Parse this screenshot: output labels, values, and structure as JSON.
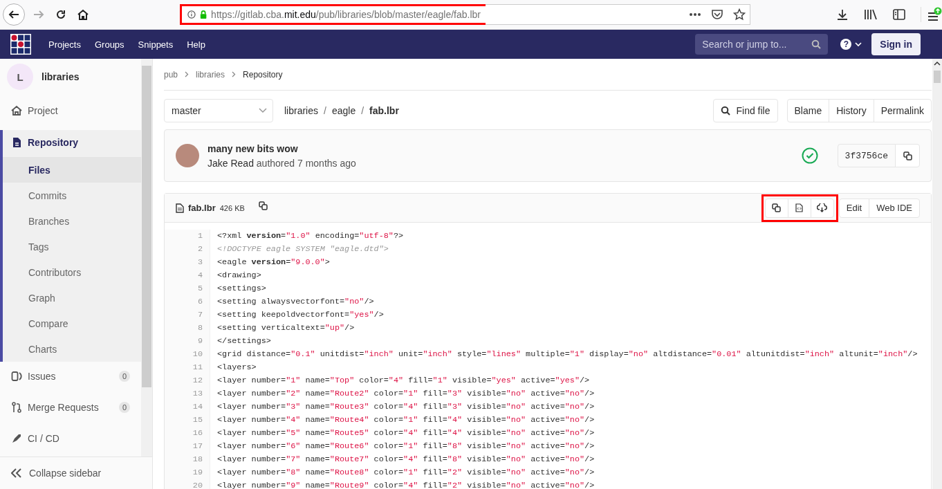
{
  "browser": {
    "url": "https://gitlab.cba.**mit.edu**/pub/libraries/blob/master/eagle/fab.lbr",
    "url_highlighted": true,
    "forward_disabled": true,
    "update_badge": true
  },
  "navbar": {
    "links": [
      "Projects",
      "Groups",
      "Snippets",
      "Help"
    ],
    "help": "?",
    "search": {
      "placeholder": "Search or jump to..."
    },
    "sign_in": "Sign in"
  },
  "sidebar": {
    "project": {
      "avatar_letter": "L",
      "name": "libraries"
    },
    "items": [
      {
        "label": "Project",
        "selected": false
      },
      {
        "label": "Repository",
        "selected": true,
        "children": [
          {
            "label": "Files",
            "selected": true
          },
          {
            "label": "Commits",
            "selected": false
          },
          {
            "label": "Branches",
            "selected": false
          },
          {
            "label": "Tags",
            "selected": false
          },
          {
            "label": "Contributors",
            "selected": false
          },
          {
            "label": "Graph",
            "selected": false
          },
          {
            "label": "Compare",
            "selected": false
          },
          {
            "label": "Charts",
            "selected": false
          }
        ]
      },
      {
        "label": "Issues",
        "selected": false,
        "count": "0"
      },
      {
        "label": "Merge Requests",
        "selected": false,
        "count": "0"
      },
      {
        "label": "CI / CD",
        "selected": false
      }
    ],
    "collapse": "Collapse sidebar"
  },
  "breadcrumbs": [
    "pub",
    "libraries",
    "Repository"
  ],
  "toolbar": {
    "branch": "master",
    "path": [
      {
        "label": "libraries"
      },
      {
        "separator": "/",
        "label": "eagle"
      },
      {
        "separator": "/",
        "label": "fab.lbr"
      }
    ],
    "find_file": "Find file",
    "buttons": [
      "Blame",
      "History",
      "Permalink"
    ]
  },
  "commit": {
    "title": "many new bits wow",
    "author": "Jake Read",
    "meta": "authored 7 months ago",
    "sha": "3f3756ce"
  },
  "file": {
    "name": "fab.lbr",
    "size": "426 KB",
    "icon_buttons_highlighted": true,
    "buttons": [
      "Edit",
      "Web IDE"
    ]
  },
  "code": [
    {
      "num": "1",
      "kind": "code",
      "segs": [
        "<?xml **version**=",
        "\"1.0\"",
        " encoding=",
        "\"utf-8\"",
        "?>"
      ]
    },
    {
      "num": "2",
      "kind": "comment",
      "segs": [
        "<!DOCTYPE eagle SYSTEM \"eagle.dtd\">"
      ]
    },
    {
      "num": "3",
      "kind": "code",
      "segs": [
        "<eagle **version**=",
        "\"9.0.0\"",
        ">"
      ]
    },
    {
      "num": "4",
      "kind": "code",
      "segs": [
        "<drawing>"
      ]
    },
    {
      "num": "5",
      "kind": "code",
      "segs": [
        "<settings>"
      ]
    },
    {
      "num": "6",
      "kind": "code",
      "segs": [
        "<setting alwaysvectorfont=",
        "\"no\"",
        "/>"
      ]
    },
    {
      "num": "7",
      "kind": "code",
      "segs": [
        "<setting keepoldvectorfont=",
        "\"yes\"",
        "/>"
      ]
    },
    {
      "num": "8",
      "kind": "code",
      "segs": [
        "<setting verticaltext=",
        "\"up\"",
        "/>"
      ]
    },
    {
      "num": "9",
      "kind": "code",
      "segs": [
        "</settings>"
      ]
    },
    {
      "num": "10",
      "kind": "code",
      "segs": [
        "<grid distance=",
        "\"0.1\"",
        " unitdist=",
        "\"inch\"",
        " unit=",
        "\"inch\"",
        " style=",
        "\"lines\"",
        " multiple=",
        "\"1\"",
        " display=",
        "\"no\"",
        " altdistance=",
        "\"0.01\"",
        " altunitdist=",
        "\"inch\"",
        " altunit=",
        "\"inch\"",
        "/>"
      ]
    },
    {
      "num": "11",
      "kind": "code",
      "segs": [
        "<layers>"
      ]
    },
    {
      "num": "12",
      "kind": "code",
      "segs": [
        "<layer number=",
        "\"1\"",
        " name=",
        "\"Top\"",
        " color=",
        "\"4\"",
        " fill=",
        "\"1\"",
        " visible=",
        "\"yes\"",
        " active=",
        "\"yes\"",
        "/>"
      ]
    },
    {
      "num": "13",
      "kind": "code",
      "segs": [
        "<layer number=",
        "\"2\"",
        " name=",
        "\"Route2\"",
        " color=",
        "\"1\"",
        " fill=",
        "\"3\"",
        " visible=",
        "\"no\"",
        " active=",
        "\"no\"",
        "/>"
      ]
    },
    {
      "num": "14",
      "kind": "code",
      "segs": [
        "<layer number=",
        "\"3\"",
        " name=",
        "\"Route3\"",
        " color=",
        "\"4\"",
        " fill=",
        "\"3\"",
        " visible=",
        "\"no\"",
        " active=",
        "\"no\"",
        "/>"
      ]
    },
    {
      "num": "15",
      "kind": "code",
      "segs": [
        "<layer number=",
        "\"4\"",
        " name=",
        "\"Route4\"",
        " color=",
        "\"1\"",
        " fill=",
        "\"4\"",
        " visible=",
        "\"no\"",
        " active=",
        "\"no\"",
        "/>"
      ]
    },
    {
      "num": "16",
      "kind": "code",
      "segs": [
        "<layer number=",
        "\"5\"",
        " name=",
        "\"Route5\"",
        " color=",
        "\"4\"",
        " fill=",
        "\"4\"",
        " visible=",
        "\"no\"",
        " active=",
        "\"no\"",
        "/>"
      ]
    },
    {
      "num": "17",
      "kind": "code",
      "segs": [
        "<layer number=",
        "\"6\"",
        " name=",
        "\"Route6\"",
        " color=",
        "\"1\"",
        " fill=",
        "\"8\"",
        " visible=",
        "\"no\"",
        " active=",
        "\"no\"",
        "/>"
      ]
    },
    {
      "num": "18",
      "kind": "code",
      "segs": [
        "<layer number=",
        "\"7\"",
        " name=",
        "\"Route7\"",
        " color=",
        "\"4\"",
        " fill=",
        "\"8\"",
        " visible=",
        "\"no\"",
        " active=",
        "\"no\"",
        "/>"
      ]
    },
    {
      "num": "19",
      "kind": "code",
      "segs": [
        "<layer number=",
        "\"8\"",
        " name=",
        "\"Route8\"",
        " color=",
        "\"1\"",
        " fill=",
        "\"2\"",
        " visible=",
        "\"no\"",
        " active=",
        "\"no\"",
        "/>"
      ]
    },
    {
      "num": "20",
      "kind": "code",
      "segs": [
        "<layer number=",
        "\"9\"",
        " name=",
        "\"Route9\"",
        " color=",
        "\"4\"",
        " fill=",
        "\"2\"",
        " visible=",
        "\"no\"",
        " active=",
        "\"no\"",
        "/>"
      ]
    }
  ]
}
